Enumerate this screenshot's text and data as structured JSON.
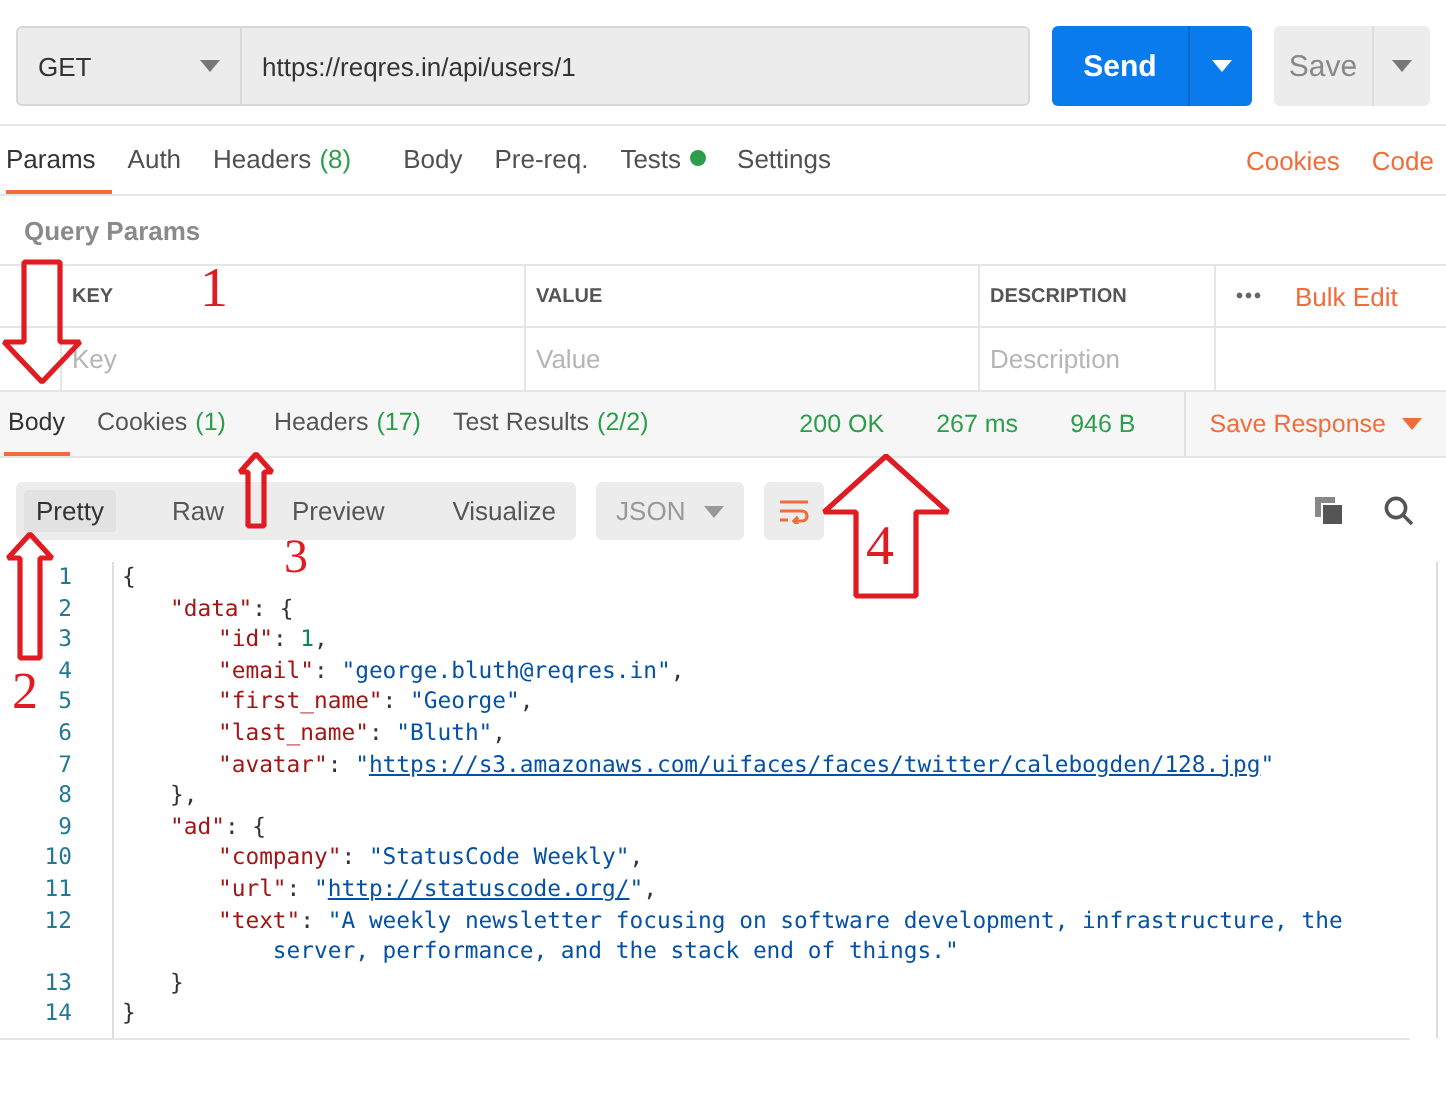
{
  "request": {
    "method": "GET",
    "url": "https://reqres.in/api/users/1",
    "send_label": "Send",
    "save_label": "Save"
  },
  "request_tabs": [
    {
      "label": "Params",
      "dot": false,
      "selected": true
    },
    {
      "label": "Auth",
      "dot": false,
      "selected": false
    },
    {
      "label": "Headers",
      "count": "(8)",
      "dot": false,
      "selected": false
    },
    {
      "label": "Body",
      "dot": false,
      "selected": false
    },
    {
      "label": "Pre-req.",
      "dot": false,
      "selected": false
    },
    {
      "label": "Tests",
      "dot": true,
      "selected": false
    },
    {
      "label": "Settings",
      "dot": false,
      "selected": false
    }
  ],
  "request_links": [
    "Cookies",
    "Code"
  ],
  "params": {
    "title": "Query Params",
    "columns": [
      "KEY",
      "VALUE",
      "DESCRIPTION"
    ],
    "more": "•••",
    "bulk_edit": "Bulk Edit",
    "placeholders": [
      "Key",
      "Value",
      "Description"
    ]
  },
  "response_tabs": [
    {
      "label": "Body",
      "selected": true
    },
    {
      "label": "Cookies",
      "count": "(1)",
      "selected": false
    },
    {
      "label": "Headers",
      "count": "(17)",
      "selected": false
    },
    {
      "label": "Test Results",
      "count": "(2/2)",
      "selected": false
    }
  ],
  "response_meta": {
    "status": "200 OK",
    "time": "267 ms",
    "size": "946 B",
    "save_label": "Save Response"
  },
  "view_modes": [
    {
      "label": "Pretty",
      "selected": true
    },
    {
      "label": "Raw",
      "selected": false
    },
    {
      "label": "Preview",
      "selected": false
    },
    {
      "label": "Visualize",
      "selected": false
    }
  ],
  "format": "JSON",
  "code": [
    {
      "number": "1",
      "parts": [
        {
          "kind": "punct",
          "text": "{"
        }
      ],
      "children": [
        {
          "number": "2",
          "parts": [
            {
              "kind": "key",
              "text": "\"data\""
            },
            {
              "kind": "punct",
              "text": ": {"
            }
          ],
          "children": [
            {
              "number": "3",
              "parts": [
                {
                  "kind": "key",
                  "text": "\"id\""
                },
                {
                  "kind": "punct",
                  "text": ": "
                },
                {
                  "kind": "number",
                  "text": "1"
                },
                {
                  "kind": "punct",
                  "text": ","
                }
              ]
            },
            {
              "number": "4",
              "parts": [
                {
                  "kind": "key",
                  "text": "\"email\""
                },
                {
                  "kind": "punct",
                  "text": ": "
                },
                {
                  "kind": "string",
                  "text": "\"george.bluth@reqres.in\""
                },
                {
                  "kind": "punct",
                  "text": ","
                }
              ]
            },
            {
              "number": "5",
              "parts": [
                {
                  "kind": "key",
                  "text": "\"first_name\""
                },
                {
                  "kind": "punct",
                  "text": ": "
                },
                {
                  "kind": "string",
                  "text": "\"George\""
                },
                {
                  "kind": "punct",
                  "text": ","
                }
              ]
            },
            {
              "number": "6",
              "parts": [
                {
                  "kind": "key",
                  "text": "\"last_name\""
                },
                {
                  "kind": "punct",
                  "text": ": "
                },
                {
                  "kind": "string",
                  "text": "\"Bluth\""
                },
                {
                  "kind": "punct",
                  "text": ","
                }
              ]
            },
            {
              "number": "7",
              "parts": [
                {
                  "kind": "key",
                  "text": "\"avatar\""
                },
                {
                  "kind": "punct",
                  "text": ": "
                },
                {
                  "kind": "string",
                  "text": "\""
                },
                {
                  "kind": "link",
                  "text": "https://s3.amazonaws.com/uifaces/faces/twitter/calebogden/128.jpg"
                },
                {
                  "kind": "string",
                  "text": "\""
                }
              ]
            }
          ]
        },
        {
          "number": "8",
          "parts": [
            {
              "kind": "punct",
              "text": "},"
            }
          ]
        },
        {
          "number": "9",
          "parts": [
            {
              "kind": "key",
              "text": "\"ad\""
            },
            {
              "kind": "punct",
              "text": ": {"
            }
          ],
          "children": [
            {
              "number": "10",
              "parts": [
                {
                  "kind": "key",
                  "text": "\"company\""
                },
                {
                  "kind": "punct",
                  "text": ": "
                },
                {
                  "kind": "string",
                  "text": "\"StatusCode Weekly\""
                },
                {
                  "kind": "punct",
                  "text": ","
                }
              ]
            },
            {
              "number": "11",
              "parts": [
                {
                  "kind": "key",
                  "text": "\"url\""
                },
                {
                  "kind": "punct",
                  "text": ": "
                },
                {
                  "kind": "string",
                  "text": "\""
                },
                {
                  "kind": "link",
                  "text": "http://statuscode.org/"
                },
                {
                  "kind": "string",
                  "text": "\""
                },
                {
                  "kind": "punct",
                  "text": ","
                }
              ]
            },
            {
              "number": "12",
              "parts": [
                {
                  "kind": "key",
                  "text": "\"text\""
                },
                {
                  "kind": "punct",
                  "text": ": "
                },
                {
                  "kind": "string",
                  "text": "\"A weekly newsletter focusing on software development, infrastructure, the server, performance, and the stack end of things.\""
                }
              ]
            }
          ]
        },
        {
          "number": "13",
          "parts": [
            {
              "kind": "punct",
              "text": "}"
            }
          ]
        }
      ]
    },
    {
      "number": "14",
      "parts": [
        {
          "kind": "punct",
          "text": "}"
        }
      ]
    }
  ],
  "annotations": [
    {
      "label": "1",
      "kind": "down"
    },
    {
      "label": "2",
      "kind": "up"
    },
    {
      "label": "3",
      "kind": "up"
    },
    {
      "label": "4",
      "kind": "up"
    }
  ]
}
